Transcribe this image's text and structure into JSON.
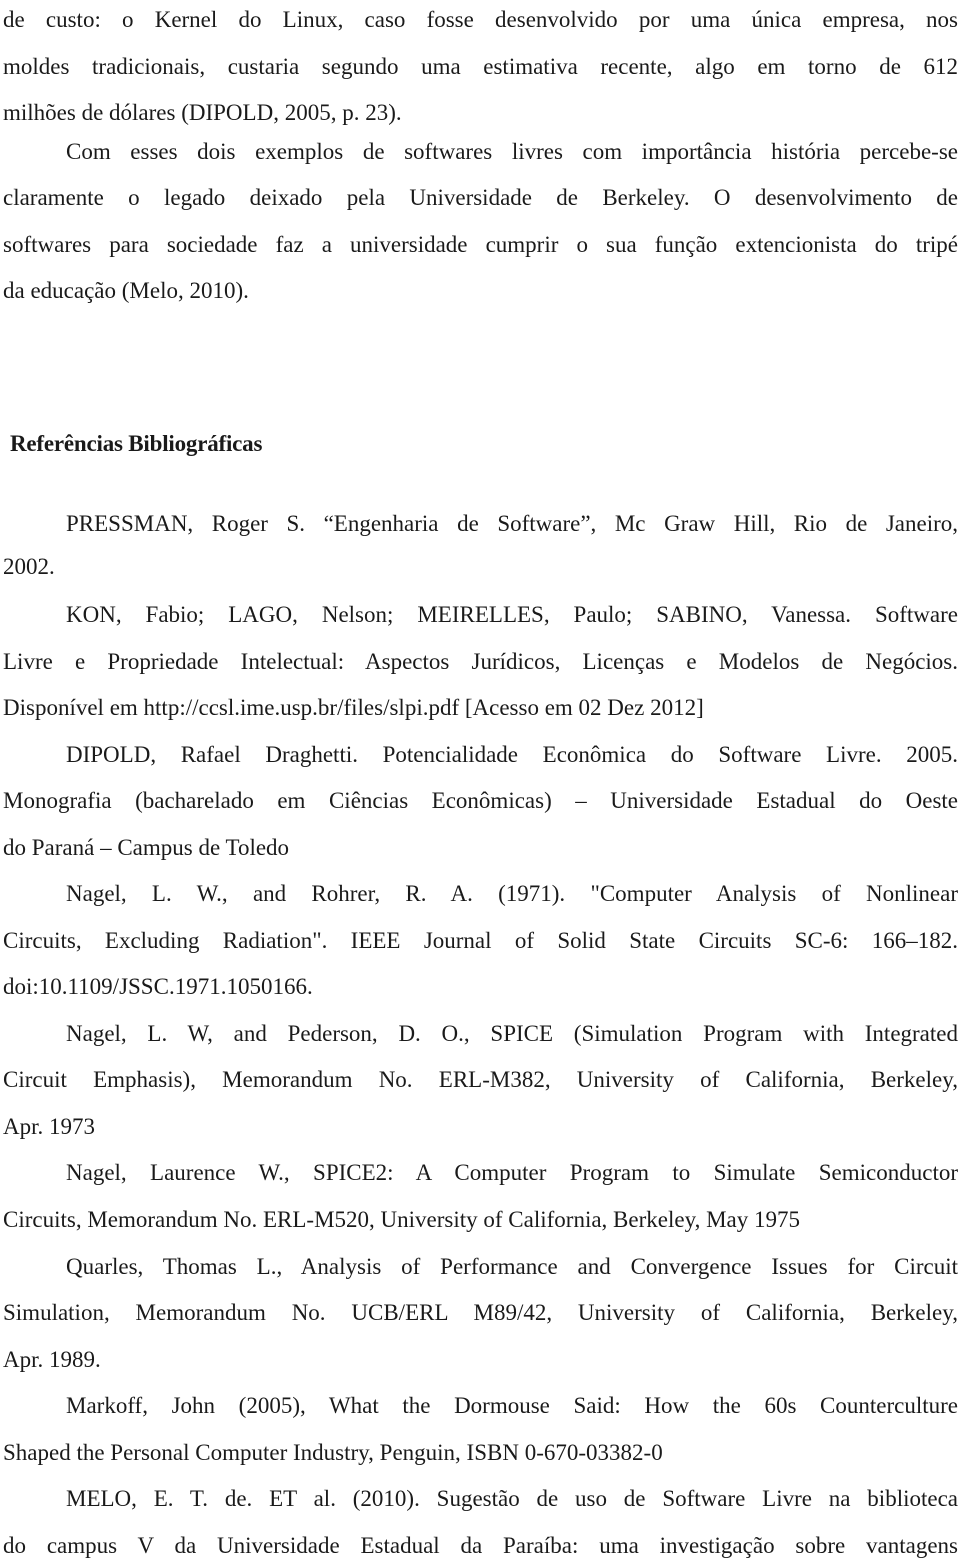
{
  "document": {
    "body_paragraphs": [
      {
        "lines": [
          "de custo: o Kernel do Linux, caso fosse desenvolvido por uma única empresa, nos",
          "moldes tradicionais, custaria segundo uma estimativa recente, algo em torno de 612",
          "milhões de dólares (DIPOLD, 2005, p. 23)."
        ]
      },
      {
        "lines": [
          "Com esses dois exemplos de softwares livres com importância história percebe-se",
          "claramente o legado deixado pela Universidade de Berkeley. O desenvolvimento de",
          "softwares para sociedade faz a universidade cumprir o sua função extencionista do tripé",
          "da educação (Melo, 2010)."
        ]
      }
    ],
    "references_heading": "Referências Bibliográficas",
    "references": [
      {
        "lines": [
          "PRESSMAN, Roger S. “Engenharia de Software”, Mc Graw Hill, Rio de Janeiro,",
          "2002."
        ]
      },
      {
        "lines": [
          "KON, Fabio; LAGO, Nelson; MEIRELLES, Paulo; SABINO, Vanessa. Software",
          "Livre e Propriedade Intelectual: Aspectos Jurídicos, Licenças e Modelos de Negócios.",
          "Disponível em http://ccsl.ime.usp.br/files/slpi.pdf [Acesso em 02 Dez 2012]"
        ]
      },
      {
        "lines": [
          "DIPOLD, Rafael Draghetti. Potencialidade Econômica do Software Livre. 2005.",
          "Monografia (bacharelado em Ciências Econômicas) – Universidade Estadual do Oeste",
          "do Paraná – Campus de Toledo"
        ]
      },
      {
        "lines": [
          "Nagel, L. W., and Rohrer, R. A. (1971). \"Computer Analysis of Nonlinear",
          "Circuits, Excluding Radiation\". IEEE Journal of Solid State Circuits SC-6: 166–182.",
          "doi:10.1109/JSSC.1971.1050166."
        ]
      },
      {
        "lines": [
          "Nagel, L. W, and Pederson, D. O., SPICE (Simulation Program with Integrated",
          "Circuit Emphasis), Memorandum No. ERL-M382, University of California, Berkeley,",
          "Apr. 1973"
        ]
      },
      {
        "lines": [
          "Nagel, Laurence W., SPICE2: A Computer Program to Simulate Semiconductor",
          "Circuits, Memorandum No. ERL-M520, University of California, Berkeley, May 1975"
        ]
      },
      {
        "lines": [
          "Quarles, Thomas L., Analysis of Performance and Convergence Issues for Circuit",
          "Simulation, Memorandum No. UCB/ERL M89/42, University of California, Berkeley,",
          "Apr. 1989."
        ]
      },
      {
        "lines": [
          "Markoff, John (2005), What the Dormouse Said: How the 60s Counterculture",
          "Shaped the Personal Computer Industry, Penguin, ISBN 0-670-03382-0"
        ]
      },
      {
        "lines": [
          "MELO, E. T. de. ET al. (2010).  Sugestão de uso de Software Livre na biblioteca",
          "do campus V da Universidade Estadual da Paraíba: uma investigação sobre vantagens"
        ]
      }
    ]
  }
}
